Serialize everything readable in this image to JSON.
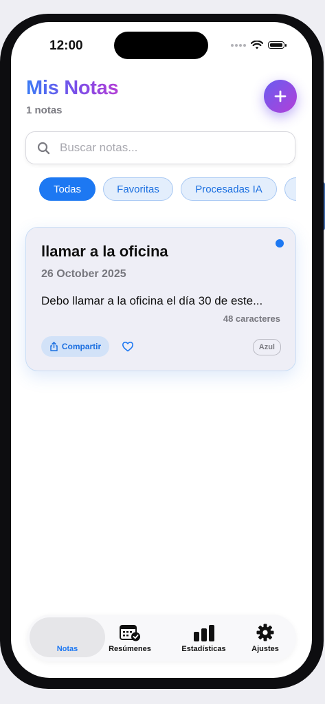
{
  "status_bar": {
    "time": "12:00"
  },
  "header": {
    "title": "Mis Notas",
    "count_label": "1 notas"
  },
  "search": {
    "placeholder": "Buscar notas..."
  },
  "filters": [
    {
      "label": "Todas",
      "active": true
    },
    {
      "label": "Favoritas",
      "active": false
    },
    {
      "label": "Procesadas IA",
      "active": false
    }
  ],
  "note_card": {
    "title": "llamar a la oficina",
    "date": "26 October 2025",
    "preview": "Debo llamar a la oficina el día 30 de este...",
    "char_count": "48 caracteres",
    "share_label": "Compartir",
    "tag": "Azul",
    "dot_color": "#1d78f2"
  },
  "tabbar": [
    {
      "label": "Notas",
      "icon": "notes-icon",
      "selected": true
    },
    {
      "label": "Resúmenes",
      "icon": "calendar-check-icon",
      "selected": false
    },
    {
      "label": "Estadísticas",
      "icon": "bar-chart-icon",
      "selected": false
    },
    {
      "label": "Ajustes",
      "icon": "gear-icon",
      "selected": false
    }
  ],
  "colors": {
    "accent": "#1d78f2",
    "title_gradient_start": "#3a7bf5",
    "title_gradient_end": "#b23ed6"
  }
}
